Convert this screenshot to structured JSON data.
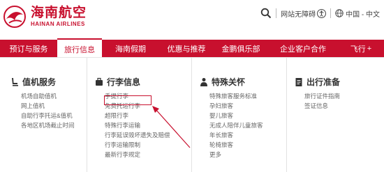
{
  "brand": {
    "name_cn": "海南航空",
    "name_en": "HAINAN AIRLINES",
    "color": "#c8102e"
  },
  "utility": {
    "search_icon": "search-icon",
    "accessible_label": "网站无障碍",
    "region_label": "中国 - 中文"
  },
  "nav": {
    "items": [
      {
        "label": "预订与服务"
      },
      {
        "label": "旅行信息"
      },
      {
        "label": "海南假期"
      },
      {
        "label": "优惠与推荐"
      },
      {
        "label": "金鹏俱乐部"
      },
      {
        "label": "企业客户合作"
      },
      {
        "label": "飞行"
      }
    ],
    "more_symbol": "+",
    "active_index": 1
  },
  "menu": {
    "columns": [
      {
        "title": "值机服务",
        "icon": "seat-icon",
        "links": [
          "机场自助值机",
          "网上值机",
          "自助行李托运&值机",
          "各地区机场截止时间"
        ]
      },
      {
        "title": "行李信息",
        "icon": "suitcase-icon",
        "links": [
          "手提行李",
          "免费托运行李",
          "超限行李",
          "特殊行李运输",
          "行李延误毁坏遗失及赔偿",
          "行李运输限制",
          "最新行李规定"
        ]
      },
      {
        "title": "特殊关怀",
        "icon": "person-icon",
        "links": [
          "特殊旅客服务标准",
          "孕妇旅客",
          "婴儿旅客",
          "无成人陪伴儿童旅客",
          "年长旅客",
          "轮椅旅客",
          "更多"
        ]
      },
      {
        "title": "出行准备",
        "icon": "document-icon",
        "links": [
          "旅行证件指南",
          "签证信息"
        ]
      }
    ]
  },
  "annotation": {
    "highlighted_link": "免费托运行李",
    "color": "#c8102e"
  }
}
